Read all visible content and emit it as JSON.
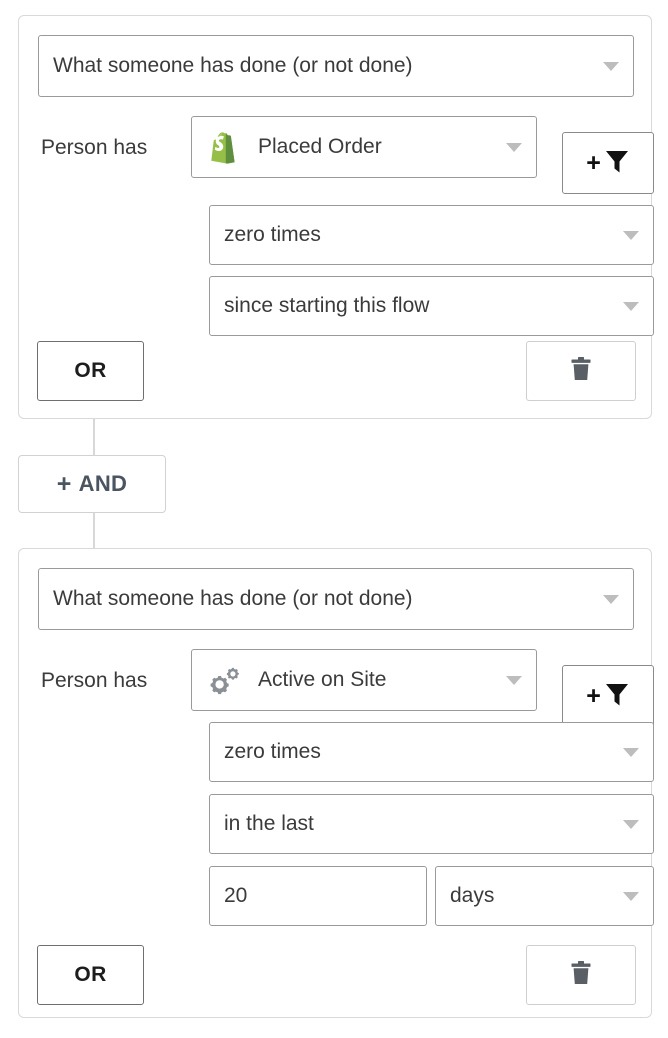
{
  "groups": [
    {
      "trigger": {
        "label": "What someone has done (or not done)",
        "icon": "chevron-down-icon"
      },
      "person_label": "Person has",
      "metric": {
        "label": "Placed Order",
        "icon": "shopify-icon"
      },
      "filter_button": {
        "plus": "+",
        "icon": "funnel-icon"
      },
      "frequency": {
        "label": "zero times"
      },
      "timeframe": {
        "label": "since starting this flow"
      },
      "has_amount_row": false,
      "amount": {
        "value": "",
        "unit": ""
      },
      "or_label": "OR",
      "delete_icon": "trash-icon"
    },
    {
      "trigger": {
        "label": "What someone has done (or not done)",
        "icon": "chevron-down-icon"
      },
      "person_label": "Person has",
      "metric": {
        "label": "Active on Site",
        "icon": "gears-icon"
      },
      "filter_button": {
        "plus": "+",
        "icon": "funnel-icon"
      },
      "frequency": {
        "label": "zero times"
      },
      "timeframe": {
        "label": "in the last"
      },
      "has_amount_row": true,
      "amount": {
        "value": "20",
        "unit": "days"
      },
      "or_label": "OR",
      "delete_icon": "trash-icon"
    }
  ],
  "connector": {
    "and_button": {
      "plus": "+",
      "label": "AND"
    }
  },
  "colors": {
    "shopify_green": "#95bf47",
    "shopify_green_dark": "#5e8e3e",
    "gear_gray": "#8b8f96",
    "trash_gray": "#5a5f66",
    "border_light": "#d9d9d9",
    "border_mid": "#9a9a9a",
    "and_text": "#4a5561"
  }
}
